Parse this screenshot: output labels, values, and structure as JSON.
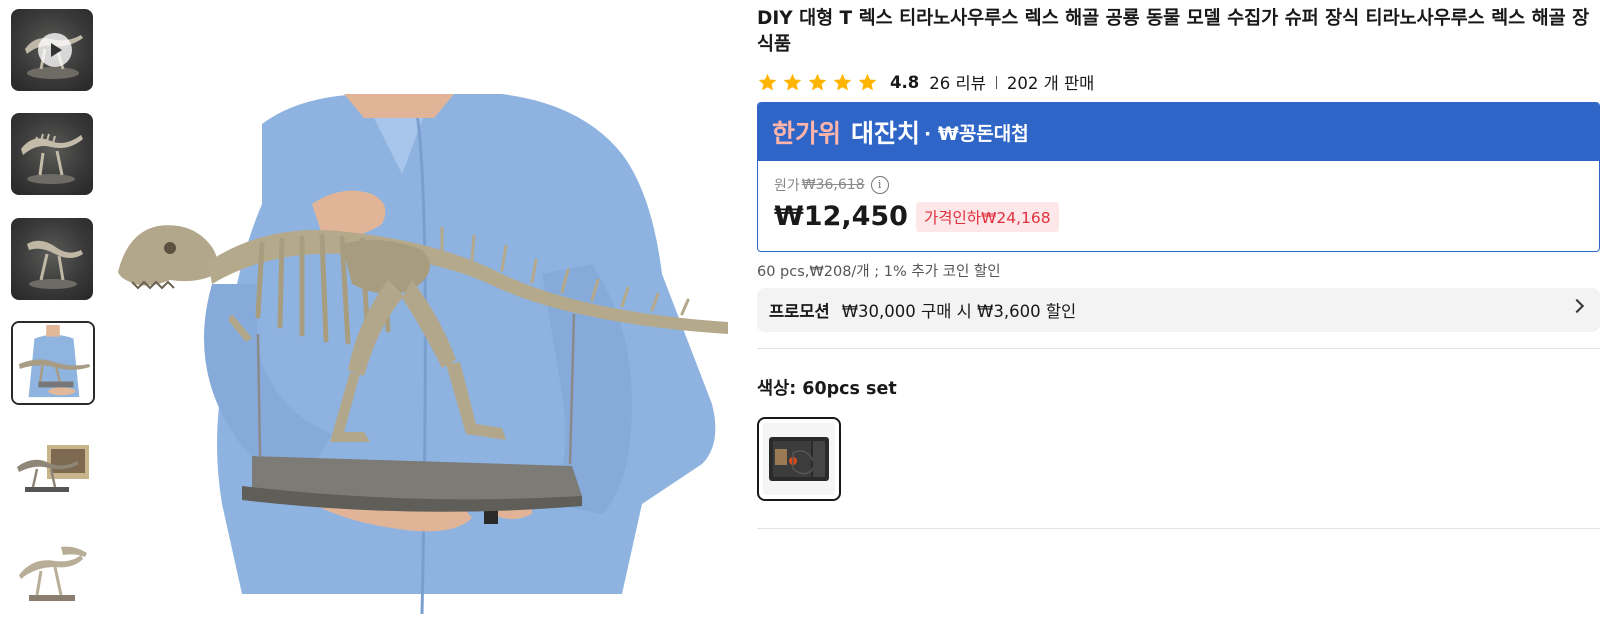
{
  "product": {
    "title": "DIY 대형 T 렉스 티라노사우루스 렉스 해골 공룡 동물 모델 수집가 슈퍼 장식 티라노사우루스 렉스 해골 장식품",
    "rating": "4.8",
    "stars": 5,
    "reviews": "26 리뷰",
    "sold": "202 개 판매"
  },
  "promo_banner": {
    "title_part1": "한가위",
    "title_part2": "대잔치",
    "title_part3": "· ₩꽁돈대첩",
    "bg_color": "#2f65c7"
  },
  "pricing": {
    "original_label": "원가",
    "original_price": "₩36,618",
    "info_icon": "info-icon",
    "price": "₩12,450",
    "discount": "가격인하₩24,168",
    "per_unit": "60 pcs,₩208/개 ; 1% 추가 코인 할인"
  },
  "promotion": {
    "label": "프로모션",
    "text": "₩30,000 구매 시 ₩3,600 할인"
  },
  "color": {
    "label": "색상: 60pcs set"
  },
  "gallery": {
    "thumbnails": [
      "video-thumbnail",
      "skeleton-dark-1",
      "skeleton-dark-2",
      "person-holding",
      "boxed-model",
      "skeleton-light"
    ],
    "active_index": 3
  },
  "colors": {
    "accent": "#2f65c7",
    "discount_red": "#e0303e",
    "star": "#ffb400"
  }
}
